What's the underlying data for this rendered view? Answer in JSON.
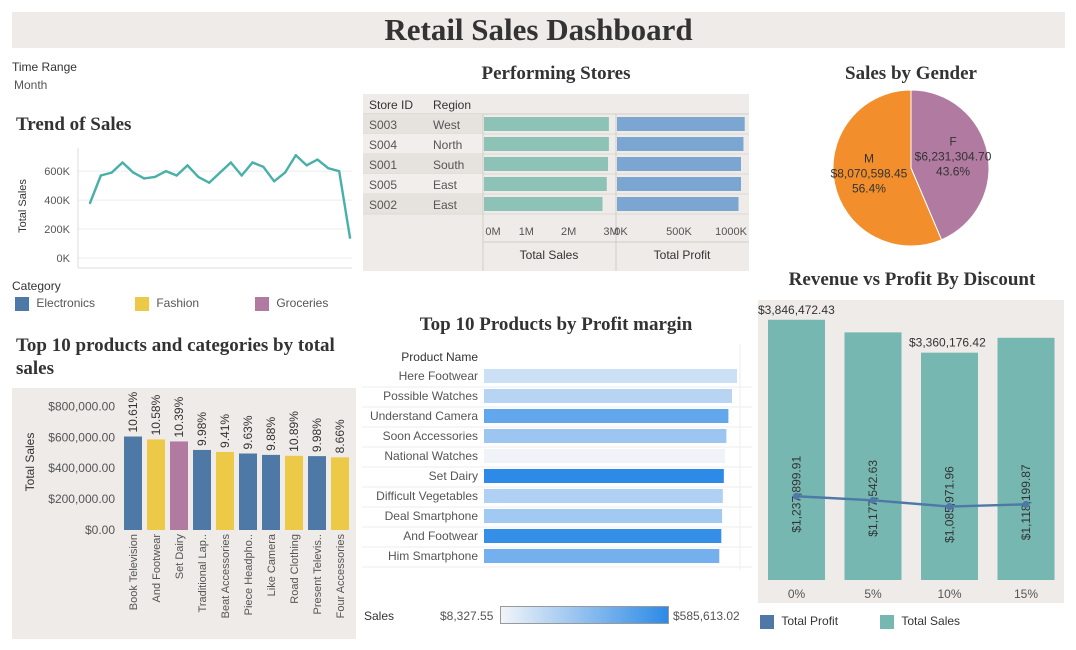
{
  "dashboard": {
    "title": "Retail Sales Dashboard"
  },
  "filter": {
    "label": "Time Range",
    "value": "Month"
  },
  "category_legend": {
    "title": "Category",
    "items": [
      {
        "label": "Electronics",
        "color": "#4e79a7"
      },
      {
        "label": "Fashion",
        "color": "#edc948"
      },
      {
        "label": "Groceries",
        "color": "#b07aa1"
      }
    ]
  },
  "sections": {
    "trend": "Trend of Sales",
    "stores": "Performing Stores",
    "gender": "Sales by Gender",
    "top10cat": "Top 10 products and categories by total sales",
    "top10margin": "Top 10 Products by Profit margin",
    "discount": "Revenue vs Profit By Discount"
  },
  "sales_gradient": {
    "label": "Sales",
    "min": "$8,327.55",
    "max": "$585,613.02"
  },
  "discount_legend": [
    {
      "label": "Total Profit",
      "color": "#4e79a7"
    },
    {
      "label": "Total Sales",
      "color": "#76b7b2"
    }
  ],
  "chart_data": [
    {
      "id": "trend",
      "type": "line",
      "ylabel": "Total Sales",
      "yticks": [
        "0K",
        "200K",
        "400K",
        "600K"
      ],
      "ylim": [
        0,
        760000
      ],
      "values": [
        380000,
        570000,
        590000,
        660000,
        590000,
        550000,
        560000,
        600000,
        570000,
        640000,
        560000,
        520000,
        590000,
        660000,
        570000,
        660000,
        630000,
        530000,
        590000,
        710000,
        640000,
        680000,
        620000,
        600000,
        140000
      ]
    },
    {
      "id": "stores",
      "type": "bar",
      "columns": [
        "Store ID",
        "Region"
      ],
      "rows": [
        {
          "store": "S003",
          "region": "West",
          "sales": 2950000,
          "profit": 1030000
        },
        {
          "store": "S004",
          "region": "North",
          "sales": 2950000,
          "profit": 1020000
        },
        {
          "store": "S001",
          "region": "South",
          "sales": 2930000,
          "profit": 1000000
        },
        {
          "store": "S005",
          "region": "East",
          "sales": 2900000,
          "profit": 1000000
        },
        {
          "store": "S002",
          "region": "East",
          "sales": 2800000,
          "profit": 980000
        }
      ],
      "sales_axis": {
        "label": "Total Sales",
        "ticks": [
          "0M",
          "1M",
          "2M",
          "3M"
        ],
        "max": 3000000
      },
      "profit_axis": {
        "label": "Total Profit",
        "ticks": [
          "0K",
          "500K",
          "1000K"
        ],
        "max": 1000000
      }
    },
    {
      "id": "gender",
      "type": "pie",
      "slices": [
        {
          "label": "F",
          "value": "$6,231,304.70",
          "pct": "43.6%",
          "share": 43.6,
          "color": "#b07aa1"
        },
        {
          "label": "M",
          "value": "$8,070,598.45",
          "pct": "56.4%",
          "share": 56.4,
          "color": "#f28e2b"
        }
      ]
    },
    {
      "id": "top10cat",
      "type": "bar",
      "ylabel": "Total Sales",
      "yticks": [
        "$0.00",
        "$200,000.00",
        "$400,000.00",
        "$600,000.00",
        "$800,000.00"
      ],
      "ylim": [
        0,
        880000
      ],
      "categories": [
        "Book Television",
        "And Footwear",
        "Set Dairy",
        "Traditional Lap..",
        "Beat Accessories",
        "Piece Headpho..",
        "Like Camera",
        "Road Clothing",
        "Present Televis..",
        "Four Accessories"
      ],
      "values": [
        605000,
        586000,
        573000,
        518000,
        505000,
        495000,
        486000,
        480000,
        478000,
        470000
      ],
      "labels": [
        "10.61%",
        "10.58%",
        "10.39%",
        "9.98%",
        "9.41%",
        "9.63%",
        "9.88%",
        "10.89%",
        "9.98%",
        "8.66%"
      ],
      "category_group": [
        "Electronics",
        "Fashion",
        "Groceries",
        "Electronics",
        "Fashion",
        "Electronics",
        "Electronics",
        "Fashion",
        "Electronics",
        "Fashion"
      ]
    },
    {
      "id": "top10margin",
      "type": "bar",
      "column": "Product Name",
      "categories": [
        "Here Footwear",
        "Possible Watches",
        "Understand Camera",
        "Soon Accessories",
        "National Watches",
        "Set Dairy",
        "Difficult Vegetables",
        "Deal Smartphone",
        "And Footwear",
        "Him Smartphone"
      ],
      "values": [
        1.0,
        0.98,
        0.966,
        0.958,
        0.953,
        0.948,
        0.944,
        0.941,
        0.938,
        0.93
      ],
      "sales": [
        120000,
        180000,
        430000,
        260000,
        10000,
        585613.02,
        200000,
        240000,
        560000,
        380000
      ]
    },
    {
      "id": "discount",
      "type": "bar",
      "categories": [
        "0%",
        "5%",
        "10%",
        "15%"
      ],
      "series": [
        {
          "name": "Total Sales",
          "values": [
            3846472.43,
            3660000,
            3360176.42,
            3580000
          ],
          "labels": [
            "$3,846,472.43",
            "",
            "$3,360,176.42",
            ""
          ]
        },
        {
          "name": "Total Profit",
          "values": [
            1237899.91,
            1177542.63,
            1085971.96,
            1118199.87
          ],
          "labels": [
            "$1,237,899.91",
            "$1,177,542.63",
            "$1,085,971.96",
            "$1,118,199.87"
          ]
        }
      ]
    }
  ]
}
